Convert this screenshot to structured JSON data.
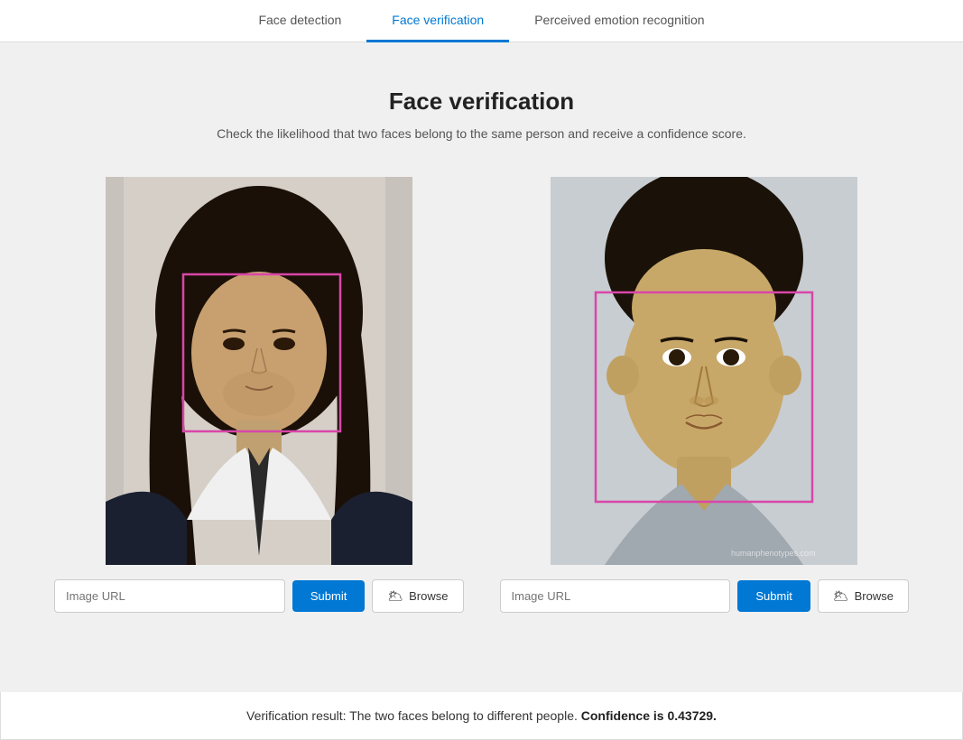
{
  "tabs": [
    {
      "id": "face-detection",
      "label": "Face detection",
      "active": false
    },
    {
      "id": "face-verification",
      "label": "Face verification",
      "active": true
    },
    {
      "id": "perceived-emotion",
      "label": "Perceived emotion recognition",
      "active": false
    }
  ],
  "page": {
    "title": "Face verification",
    "subtitle": "Check the likelihood that two faces belong to the same person and receive a confidence score."
  },
  "image_panel_1": {
    "url_placeholder": "Image URL",
    "submit_label": "Submit",
    "browse_label": "Browse"
  },
  "image_panel_2": {
    "url_placeholder": "Image URL",
    "submit_label": "Submit",
    "browse_label": "Browse"
  },
  "result": {
    "text": "Verification result: The two faces belong to different people.",
    "confidence_label": "Confidence is 0.43729."
  },
  "icons": {
    "cloud": "🌥"
  }
}
